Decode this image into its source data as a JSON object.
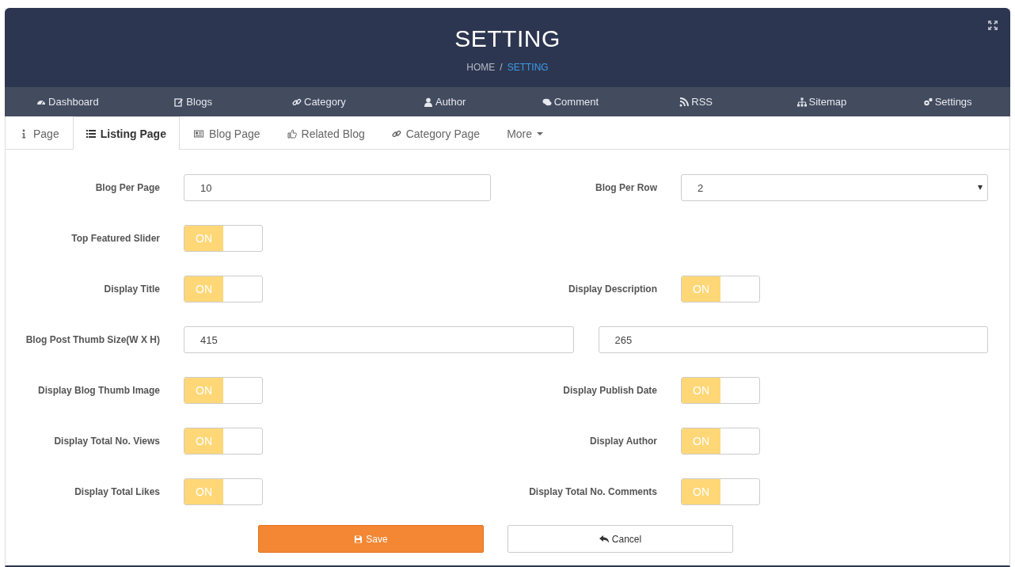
{
  "header": {
    "title": "SETTING",
    "separator": "/",
    "breadcrumb": [
      {
        "label": "HOME",
        "selected": false
      },
      {
        "label": "SETTING",
        "selected": true
      }
    ]
  },
  "nav": [
    {
      "label": "Dashboard"
    },
    {
      "label": "Blogs"
    },
    {
      "label": "Category"
    },
    {
      "label": "Author"
    },
    {
      "label": "Comment"
    },
    {
      "label": "RSS"
    },
    {
      "label": "Sitemap"
    },
    {
      "label": "Settings"
    }
  ],
  "tabs": [
    {
      "label": "Page",
      "selected": false
    },
    {
      "label": "Listing Page",
      "selected": true
    },
    {
      "label": "Blog Page",
      "selected": false
    },
    {
      "label": "Related Blog",
      "selected": false
    },
    {
      "label": "Category Page",
      "selected": false
    },
    {
      "label": "More",
      "selected": false
    }
  ],
  "form": {
    "rows": [
      {
        "fields": [
          {
            "kind": "input",
            "label": "Blog Per Page",
            "value": "10"
          },
          {
            "kind": "select",
            "label": "Blog Per Row",
            "value": "2"
          }
        ]
      },
      {
        "fields": [
          {
            "kind": "toggle",
            "label": "Top Featured Slider",
            "on": true,
            "text": "ON"
          }
        ]
      },
      {
        "fields": [
          {
            "kind": "toggle",
            "label": "Display Title",
            "on": true,
            "text": "ON"
          },
          {
            "kind": "toggle",
            "label": "Display Description",
            "on": true,
            "text": "ON"
          }
        ]
      },
      {
        "fields": [
          {
            "kind": "pair",
            "label": "Blog Post Thumb Size(W X H)",
            "values": [
              "415",
              "265"
            ]
          }
        ]
      },
      {
        "fields": [
          {
            "kind": "toggle",
            "label": "Display Blog Thumb Image",
            "on": true,
            "text": "ON"
          },
          {
            "kind": "toggle",
            "label": "Display Publish Date",
            "on": true,
            "text": "ON"
          }
        ]
      },
      {
        "fields": [
          {
            "kind": "toggle",
            "label": "Display Total No. Views",
            "on": true,
            "text": "ON"
          },
          {
            "kind": "toggle",
            "label": "Display Author",
            "on": true,
            "text": "ON"
          }
        ]
      },
      {
        "fields": [
          {
            "kind": "toggle",
            "label": "Display Total Likes",
            "on": true,
            "text": "ON"
          },
          {
            "kind": "toggle",
            "label": "Display Total No. Comments",
            "on": true,
            "text": "ON"
          }
        ]
      }
    ]
  },
  "buttons": [
    {
      "label": "Save",
      "kind": "primary"
    },
    {
      "label": "Cancel",
      "kind": "default"
    }
  ]
}
